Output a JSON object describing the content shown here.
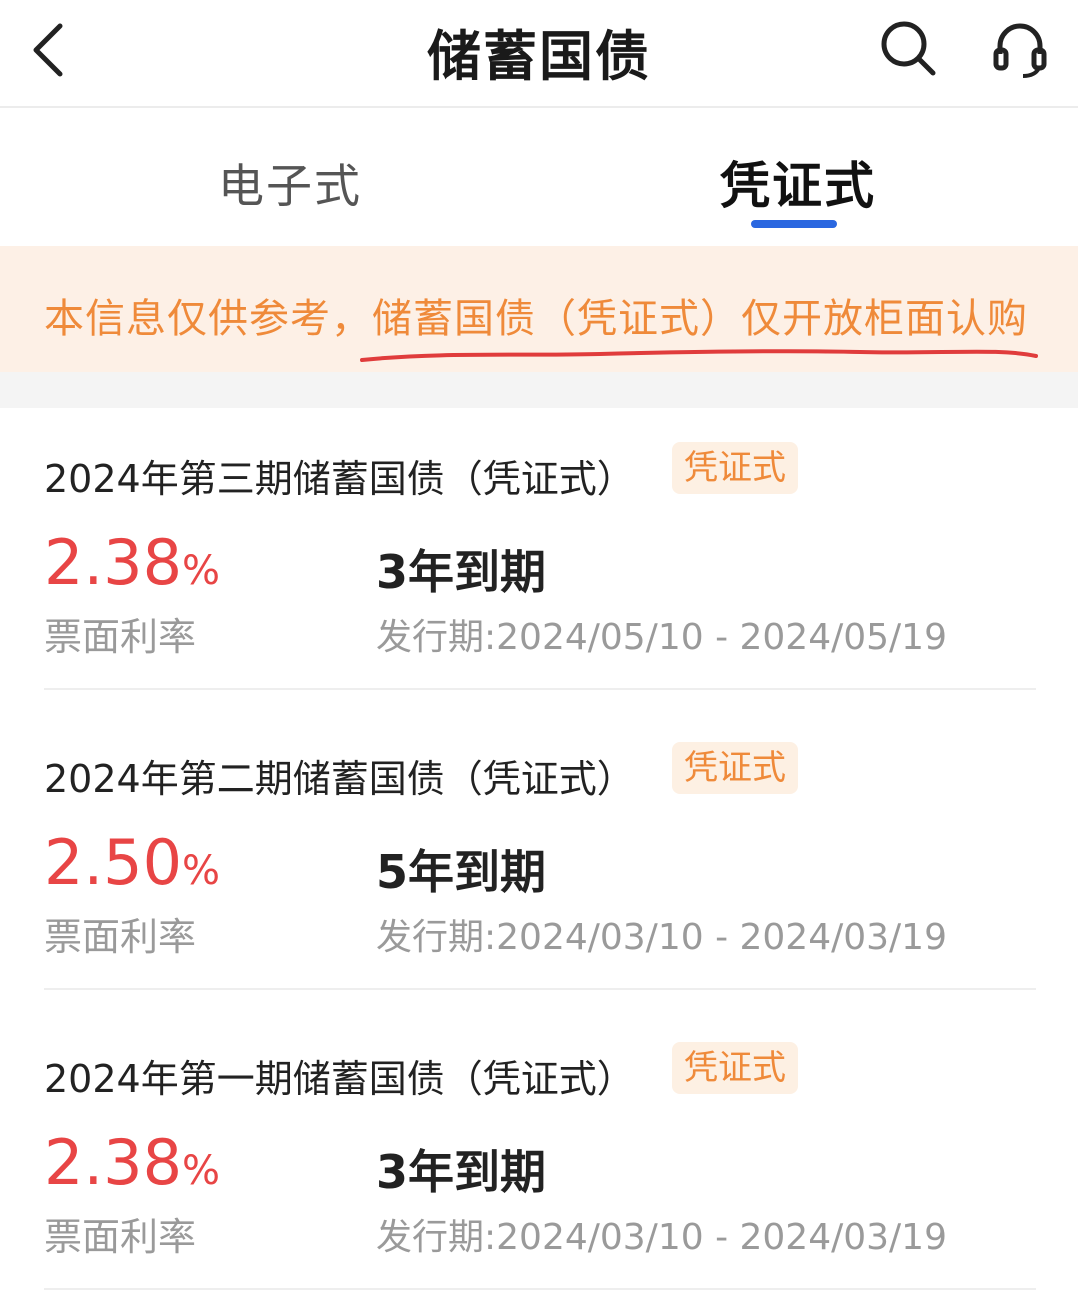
{
  "nav": {
    "title": "储蓄国债",
    "icons": [
      "back-arrow-icon",
      "search-icon",
      "headset-icon"
    ]
  },
  "tabs": [
    {
      "label": "电子式",
      "active": false
    },
    {
      "label": "凭证式",
      "active": true
    }
  ],
  "notice": {
    "text": "本信息仅供参考，储蓄国债（凭证式）仅开放柜面认购",
    "accent_color": "#ef8a3a",
    "mark_color": "#e03c3c"
  },
  "colors": {
    "rate": "#e84545",
    "tab_indicator": "#2a67e0",
    "badge_bg": "#fdf0e3"
  },
  "bonds": [
    {
      "name": "2024年第三期储蓄国债（凭证式）",
      "badge": "凭证式",
      "rate_value": "2.38",
      "rate_unit": "%",
      "rate_label": "票面利率",
      "term": "3年到期",
      "period": "发行期:2024/05/10 - 2024/05/19"
    },
    {
      "name": "2024年第二期储蓄国债（凭证式）",
      "badge": "凭证式",
      "rate_value": "2.50",
      "rate_unit": "%",
      "rate_label": "票面利率",
      "term": "5年到期",
      "period": "发行期:2024/03/10 - 2024/03/19"
    },
    {
      "name": "2024年第一期储蓄国债（凭证式）",
      "badge": "凭证式",
      "rate_value": "2.38",
      "rate_unit": "%",
      "rate_label": "票面利率",
      "term": "3年到期",
      "period": "发行期:2024/03/10 - 2024/03/19"
    }
  ]
}
